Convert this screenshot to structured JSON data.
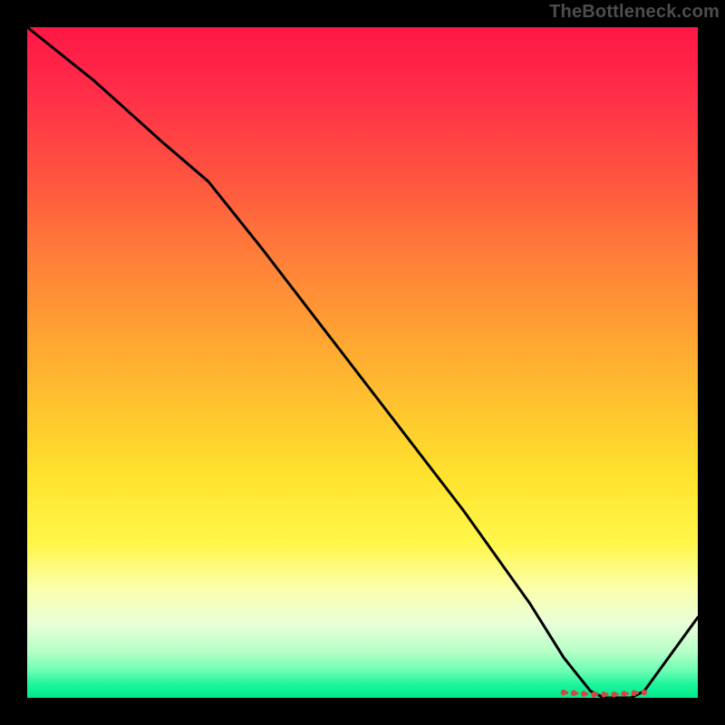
{
  "watermark": "TheBottleneck.com",
  "chart_data": {
    "type": "line",
    "title": "",
    "xlabel": "",
    "ylabel": "",
    "xlim": [
      0,
      100
    ],
    "ylim": [
      0,
      100
    ],
    "series": [
      {
        "name": "curve",
        "x": [
          0,
          10,
          20,
          27,
          35,
          45,
          55,
          65,
          75,
          80,
          84,
          86,
          88,
          90,
          92,
          100
        ],
        "y": [
          100,
          92,
          83,
          77,
          67,
          54,
          41,
          28,
          14,
          6,
          1,
          0,
          0,
          0,
          1,
          12
        ]
      }
    ],
    "flat_region": {
      "x_start": 80,
      "x_end": 92,
      "y": 0
    },
    "markers": {
      "name": "bottom-cluster",
      "x": [
        80,
        81.5,
        83,
        84.5,
        86,
        87.5,
        89,
        90.5,
        92
      ],
      "y": [
        0.8,
        0.7,
        0.6,
        0.5,
        0.5,
        0.5,
        0.6,
        0.7,
        0.8
      ]
    },
    "colors": {
      "curve": "#000000",
      "marker": "#d8453f",
      "gradient_top": "#ff1744",
      "gradient_bottom": "#00e98b"
    }
  }
}
